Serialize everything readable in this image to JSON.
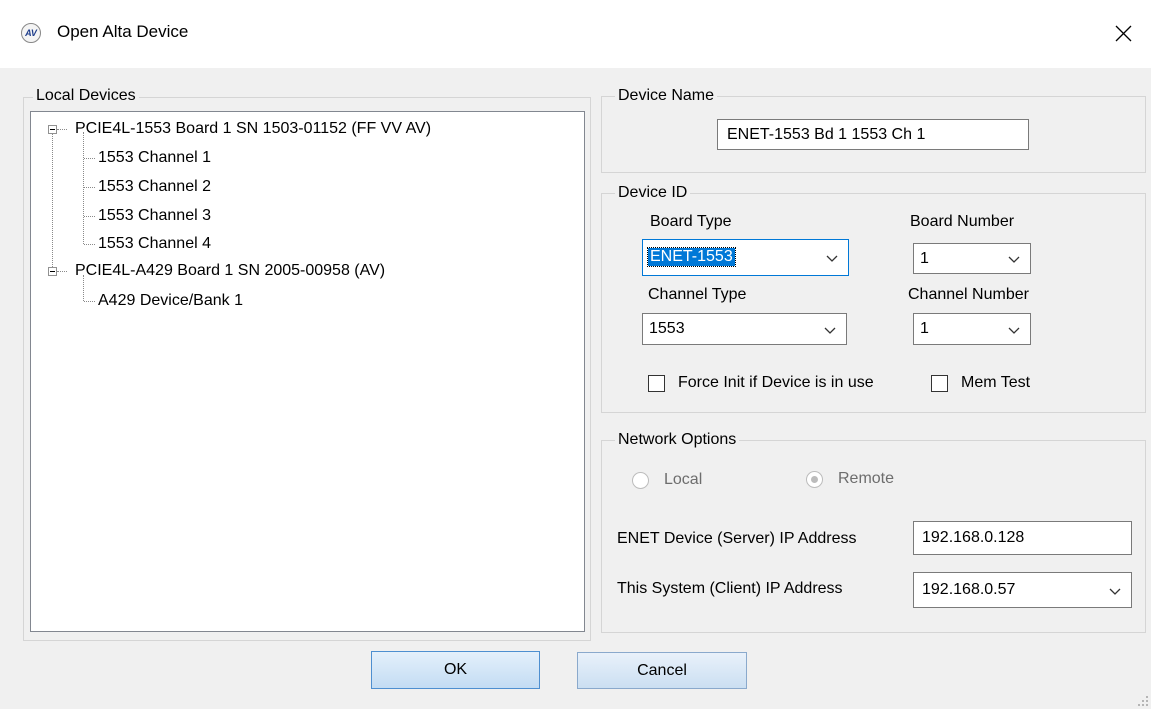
{
  "window": {
    "title": "Open Alta Device",
    "icon": "alta-logo-icon",
    "icon_text": "AV",
    "close_glyph": "✕"
  },
  "local_devices": {
    "legend": "Local Devices",
    "tree": [
      {
        "label": "PCIE4L-1553 Board 1 SN 1503-01152 (FF VV AV)",
        "expanded": true,
        "children": [
          "1553 Channel 1",
          "1553 Channel 2",
          "1553 Channel 3",
          "1553 Channel 4"
        ]
      },
      {
        "label": "PCIE4L-A429 Board 1 SN 2005-00958 (AV)",
        "expanded": true,
        "children": [
          "A429 Device/Bank 1"
        ]
      }
    ]
  },
  "device_name": {
    "legend": "Device Name",
    "value": "ENET-1553 Bd 1 1553 Ch 1"
  },
  "device_id": {
    "legend": "Device ID",
    "board_type_label": "Board Type",
    "board_type_value": "ENET-1553",
    "board_number_label": "Board Number",
    "board_number_value": "1",
    "channel_type_label": "Channel Type",
    "channel_type_value": "1553",
    "channel_number_label": "Channel Number",
    "channel_number_value": "1",
    "force_init_label": "Force Init if Device is in use",
    "force_init_checked": false,
    "mem_test_label": "Mem Test",
    "mem_test_checked": false
  },
  "network_options": {
    "legend": "Network Options",
    "local_label": "Local",
    "remote_label": "Remote",
    "selected": "Remote",
    "enabled": false,
    "server_ip_label": "ENET Device (Server) IP Address",
    "server_ip_value": "192.168.0.128",
    "client_ip_label": "This System (Client) IP Address",
    "client_ip_value": "192.168.0.57"
  },
  "buttons": {
    "ok": "OK",
    "cancel": "Cancel"
  },
  "colors": {
    "accent": "#0078d7",
    "button_fill": "#cce4f7",
    "dialog_bg": "#f0f0f0"
  }
}
